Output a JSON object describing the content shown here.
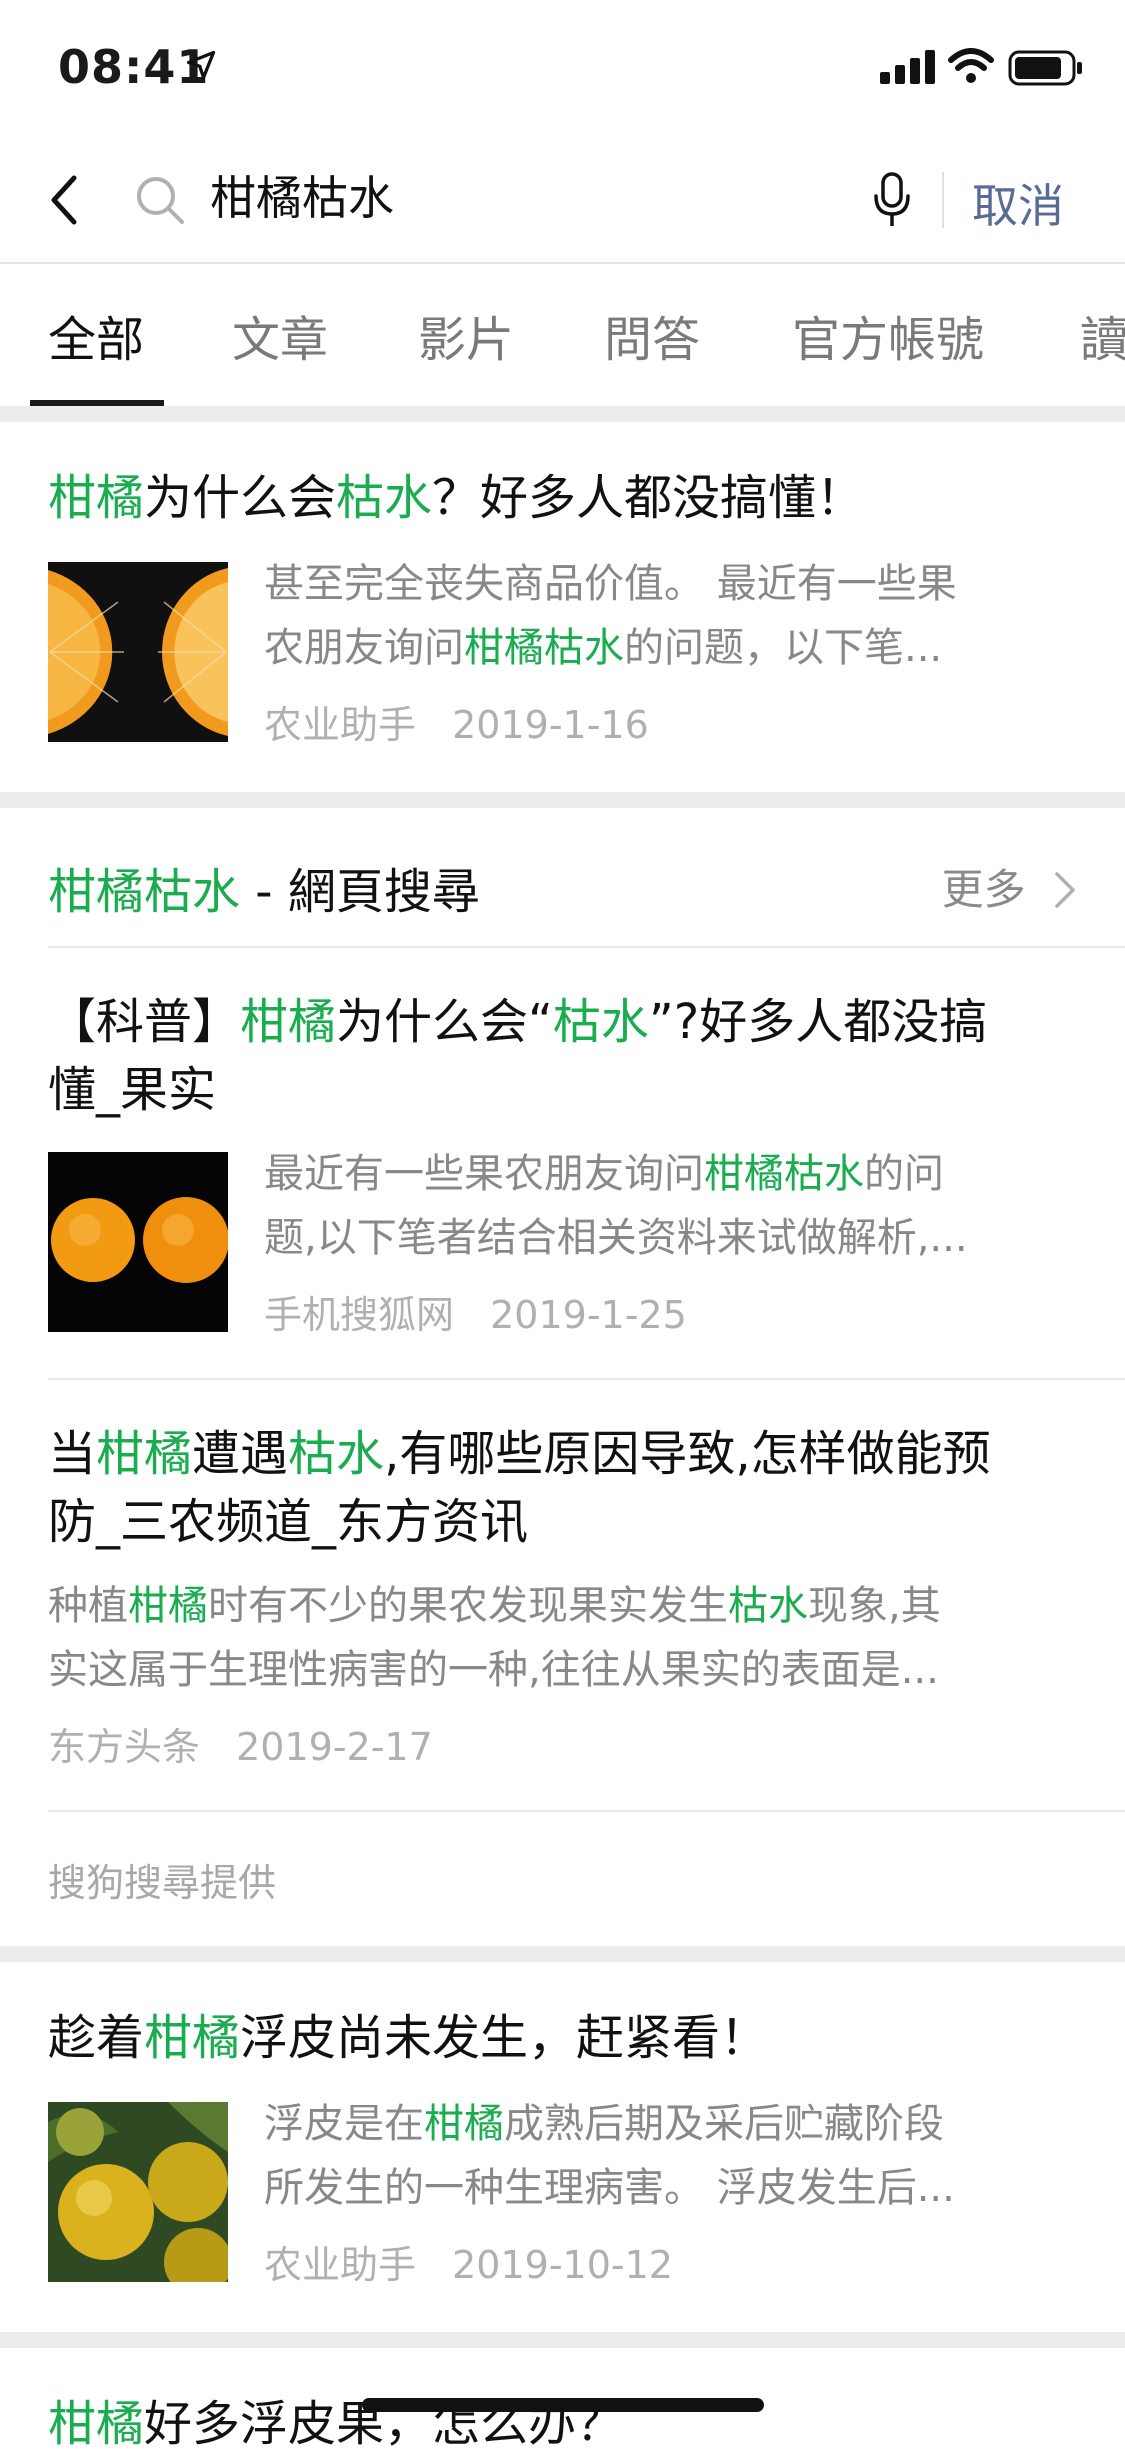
{
  "status_bar": {
    "time": "08:41"
  },
  "search": {
    "query": "柑橘枯水",
    "cancel_label": "取消"
  },
  "tabs": [
    "全部",
    "文章",
    "影片",
    "問答",
    "官方帳號",
    "讀"
  ],
  "results": [
    {
      "title_segments": [
        [
          "柑橘",
          true
        ],
        [
          "为什么会",
          false
        ],
        [
          "枯水",
          true
        ],
        [
          "？好多人都没搞懂！",
          false
        ]
      ],
      "desc_lines": [
        [
          [
            "甚至完全丧失商品价值。 最近有一些果",
            false
          ]
        ],
        [
          [
            "农朋友询问",
            false
          ],
          [
            "柑橘枯水",
            true
          ],
          [
            "的问题，以下笔...",
            false
          ]
        ]
      ],
      "source": "农业助手",
      "date": "2019-1-16"
    }
  ],
  "web_search": {
    "header_hl": "柑橘枯水",
    "header_rest": " - 網頁搜尋",
    "more_label": "更多",
    "items": [
      {
        "title_lines": [
          [
            [
              "【科普】",
              false
            ],
            [
              "柑橘",
              true
            ],
            [
              "为什么会“",
              false
            ],
            [
              "枯水",
              true
            ],
            [
              "”?好多人都没搞",
              false
            ]
          ],
          [
            [
              "懂_果实",
              false
            ]
          ]
        ],
        "desc_lines": [
          [
            [
              "最近有一些果农朋友询问",
              false
            ],
            [
              "柑橘枯水",
              true
            ],
            [
              "的问",
              false
            ]
          ],
          [
            [
              "题,以下笔者结合相关资料来试做解析,...",
              false
            ]
          ]
        ],
        "source": "手机搜狐网",
        "date": "2019-1-25"
      },
      {
        "title_lines": [
          [
            [
              "当",
              false
            ],
            [
              "柑橘",
              true
            ],
            [
              "遭遇",
              false
            ],
            [
              "枯水",
              true
            ],
            [
              ",有哪些原因导致,怎样做能预",
              false
            ]
          ],
          [
            [
              "防_三农频道_东方资讯",
              false
            ]
          ]
        ],
        "desc_lines": [
          [
            [
              "种植",
              false
            ],
            [
              "柑橘",
              true
            ],
            [
              "时有不少的果农发现果实发生",
              false
            ],
            [
              "枯水",
              true
            ],
            [
              "现象,其",
              false
            ]
          ],
          [
            [
              "实这属于生理性病害的一种,往往从果实的表面是...",
              false
            ]
          ]
        ],
        "source": "东方头条",
        "date": "2019-2-17"
      }
    ],
    "provider": "搜狗搜尋提供"
  },
  "result3": {
    "title_segments": [
      [
        "趁着",
        false
      ],
      [
        "柑橘",
        true
      ],
      [
        "浮皮尚未发生，赶紧看！",
        false
      ]
    ],
    "desc_lines": [
      [
        [
          "浮皮是在",
          false
        ],
        [
          "柑橘",
          true
        ],
        [
          "成熟后期及采后贮藏阶段",
          false
        ]
      ],
      [
        [
          "所发生的一种生理病害。 浮皮发生后...",
          false
        ]
      ]
    ],
    "source": "农业助手",
    "date": "2019-10-12"
  },
  "result4": {
    "title_segments": [
      [
        "柑橘",
        true
      ],
      [
        "好多浮皮果，怎么办？",
        false
      ]
    ]
  },
  "colors": {
    "highlight": "#1aad4f",
    "link": "#576b95"
  }
}
